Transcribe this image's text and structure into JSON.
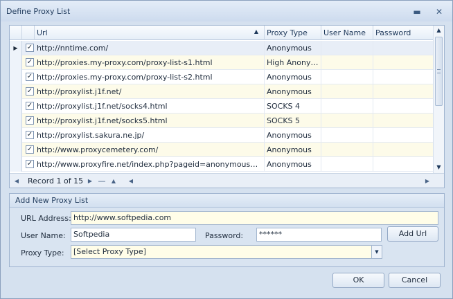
{
  "window": {
    "title": "Define Proxy List"
  },
  "grid": {
    "columns": [
      "Url",
      "Proxy Type",
      "User Name",
      "Password"
    ],
    "rows": [
      {
        "url": "http://nntime.com/",
        "type": "Anonymous"
      },
      {
        "url": "http://proxies.my-proxy.com/proxy-list-s1.html",
        "type": "High Anonym..."
      },
      {
        "url": "http://proxies.my-proxy.com/proxy-list-s2.html",
        "type": "Anonymous"
      },
      {
        "url": "http://proxylist.j1f.net/",
        "type": "Anonymous"
      },
      {
        "url": "http://proxylist.j1f.net/socks4.html",
        "type": "SOCKS 4"
      },
      {
        "url": "http://proxylist.j1f.net/socks5.html",
        "type": "SOCKS 5"
      },
      {
        "url": "http://proxylist.sakura.ne.jp/",
        "type": "Anonymous"
      },
      {
        "url": "http://www.proxycemetery.com/",
        "type": "Anonymous"
      },
      {
        "url": "http://www.proxyfire.net/index.php?pageid=anonymousproxylist",
        "type": "Anonymous"
      }
    ],
    "navigator": {
      "record_text": "Record 1 of 15"
    }
  },
  "add_group": {
    "title": "Add New Proxy List",
    "url_label": "URL Address:",
    "url_value": "http://www.softpedia.com",
    "user_label": "User Name:",
    "user_value": "Softpedia",
    "password_label": "Password:",
    "password_value": "******",
    "add_button": "Add Url",
    "type_label": "Proxy Type:",
    "type_value": "[Select Proxy Type]"
  },
  "footer": {
    "ok": "OK",
    "cancel": "Cancel"
  }
}
